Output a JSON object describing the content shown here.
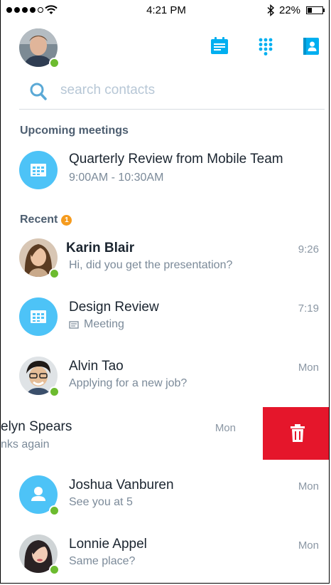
{
  "status_bar": {
    "time": "4:21 PM",
    "battery": "22%",
    "battery_level": 0.22,
    "signal_bars_filled": 4,
    "signal_bars_total": 5
  },
  "header": {
    "icons": [
      "calendar-icon",
      "dialpad-icon",
      "contacts-icon"
    ],
    "accent_color": "#00aff0"
  },
  "search": {
    "placeholder": "search contacts"
  },
  "upcoming": {
    "label": "Upcoming meetings",
    "items": [
      {
        "title": "Quarterly Review from Mobile Team",
        "time": "9:00AM - 10:30AM"
      }
    ]
  },
  "recent": {
    "label": "Recent",
    "badge": "1",
    "items": [
      {
        "name": "Karin Blair",
        "message": "Hi, did you get the presentation?",
        "time": "9:26",
        "online": true,
        "unread": true
      },
      {
        "name": "Design Review",
        "message": "Meeting",
        "time": "7:19"
      },
      {
        "name": "Alvin Tao",
        "message": "Applying for a new job?",
        "time": "Mon",
        "online": true
      },
      {
        "name": "elyn Spears",
        "message": "nks again",
        "time": "Mon"
      },
      {
        "name": "Joshua Vanburen",
        "message": "See you at 5",
        "time": "Mon",
        "online": true
      },
      {
        "name": "Lonnie Appel",
        "message": "Same place?",
        "time": "Mon",
        "online": true
      }
    ]
  },
  "swipe_action": {
    "icon": "trash-icon",
    "color": "#e5162b"
  }
}
